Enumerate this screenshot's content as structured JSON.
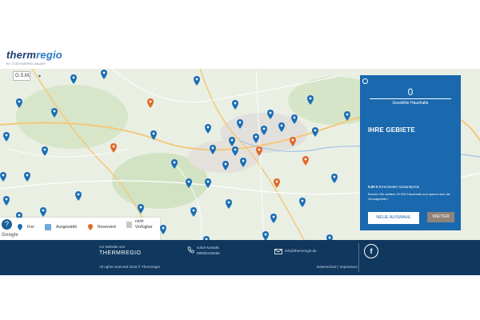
{
  "header": {
    "logo_main": "therm",
    "logo_accent": "regio",
    "logo_tagline": "BY STADTWERKE-BAUER"
  },
  "map": {
    "layer_select_value": "O.S.M.",
    "attribution": "Google",
    "colors": {
      "free": "#1a6fb5",
      "reserved": "#e06a2c",
      "selected": "#6fa9d8",
      "unavailable": "#c8c8c8"
    }
  },
  "legend": {
    "help": "?",
    "free": "Frei",
    "selected": "Ausgewählt",
    "reserved": "Reserviert",
    "unavailable": "nicht Verfügbar"
  },
  "panel": {
    "count": "0",
    "count_label": "Gewählte Haushalte",
    "title": "IHRE GEBIETE",
    "price_value": "0,00 €",
    "price_label": "Errechneter Gesamtpreis",
    "hint": "Buchen Sie weitere 10.000 Haushalte und sparen sich die Grundgebühr!",
    "new_selection_button": "NEUE AUSWAHL",
    "next_button": "WEITER",
    "zoom_in": "+",
    "zoom_out": "−"
  },
  "footer": {
    "website_label": "zur Website von",
    "brand": "THERMREGIO",
    "rights": "All rights reserved 2018 © Thermregio",
    "contact_label": "sofort-kontakt:",
    "phone": "0800/5105555",
    "email": "info@thermregio.de",
    "facebook": "f",
    "links": "Datenschutz | Impressum"
  }
}
